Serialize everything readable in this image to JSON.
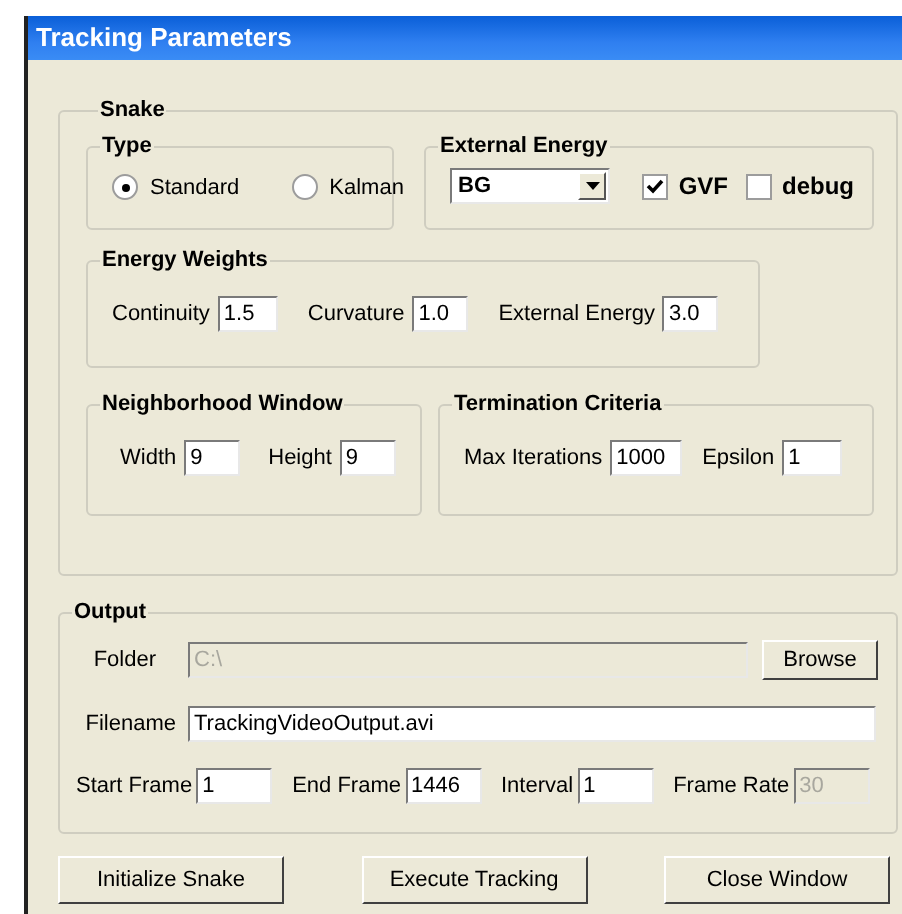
{
  "window": {
    "title": "Tracking Parameters"
  },
  "snake": {
    "title": "Snake",
    "type": {
      "title": "Type",
      "options": [
        {
          "label": "Standard",
          "selected": true
        },
        {
          "label": "Kalman",
          "selected": false
        }
      ]
    },
    "external_energy": {
      "title": "External Energy",
      "dropdown": "BG",
      "checkboxes": [
        {
          "label": "GVF",
          "checked": true
        },
        {
          "label": "debug",
          "checked": false
        }
      ]
    },
    "energy_weights": {
      "title": "Energy Weights",
      "fields": [
        {
          "label": "Continuity",
          "value": "1.5"
        },
        {
          "label": "Curvature",
          "value": "1.0"
        },
        {
          "label": "External Energy",
          "value": "3.0"
        }
      ]
    },
    "neighborhood_window": {
      "title": "Neighborhood Window",
      "fields": [
        {
          "label": "Width",
          "value": "9"
        },
        {
          "label": "Height",
          "value": "9"
        }
      ]
    },
    "termination_criteria": {
      "title": "Termination Criteria",
      "fields": [
        {
          "label": "Max Iterations",
          "value": "1000"
        },
        {
          "label": "Epsilon",
          "value": "1"
        }
      ]
    }
  },
  "output": {
    "title": "Output",
    "folder": {
      "label": "Folder",
      "value": "C:\\",
      "disabled": true
    },
    "browse": "Browse",
    "filename": {
      "label": "Filename",
      "value": "TrackingVideoOutput.avi",
      "disabled": false
    },
    "fields": [
      {
        "label": "Start Frame",
        "value": "1",
        "disabled": false
      },
      {
        "label": "End Frame",
        "value": "1446",
        "disabled": false
      },
      {
        "label": "Interval",
        "value": "1",
        "disabled": false
      },
      {
        "label": "Frame Rate",
        "value": "30",
        "disabled": true
      }
    ]
  },
  "buttons": [
    "Initialize Snake",
    "Execute Tracking",
    "Close Window"
  ]
}
